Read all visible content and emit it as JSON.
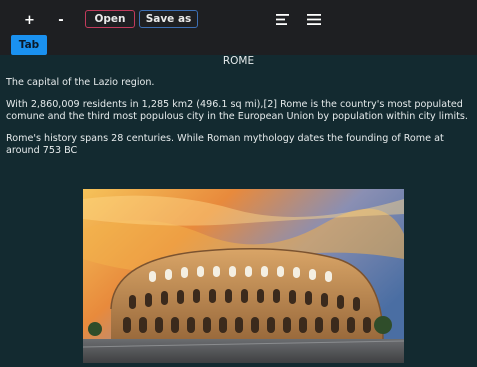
{
  "toolbar": {
    "zoom_in_label": "+",
    "zoom_out_label": "-",
    "open_label": "Open",
    "save_as_label": "Save as",
    "icons": [
      "align-left-icon",
      "menu-icon"
    ]
  },
  "tabs": [
    {
      "label": "Tab",
      "active": true
    }
  ],
  "document": {
    "title": "ROME",
    "paragraphs": [
      "The capital of the Lazio region.",
      "With 2,860,009 residents in 1,285 km2 (496.1 sq mi),[2] Rome is the country's most populated comune and the third most populous city in the European Union by population within city limits.",
      "Rome's history spans 28 centuries. While Roman mythology dates the founding of Rome at around 753 BC"
    ],
    "image": "colosseum-photo"
  },
  "colors": {
    "toolbar_bg": "#1e1f22",
    "content_bg": "#132a30",
    "open_border": "#c23b5c",
    "save_as_border": "#3d6fb4",
    "tab_bg": "#1a91f0"
  }
}
